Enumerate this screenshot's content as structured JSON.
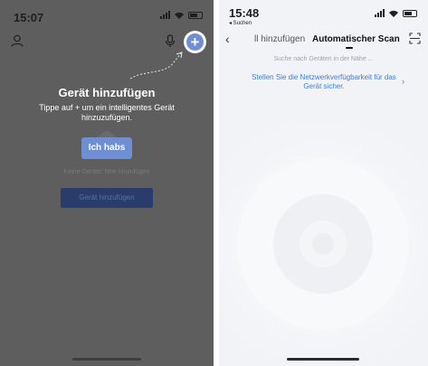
{
  "left": {
    "status_time": "15:07",
    "title": "Gerät hinzufügen",
    "subtitle": "Tippe auf + um ein intelligentes Gerät hinzuzufügen.",
    "ok_button": "Ich habs",
    "empty_text": "Keine Geräte; bitte hinzufügen",
    "add_device_button": "Gerät hinzufügen",
    "add_symbol": "+"
  },
  "right": {
    "status_time": "15:48",
    "back_app": "◂ Suchen",
    "tab_manual": "ll hinzufügen",
    "tab_auto": "Automatischer Scan",
    "searching": "Suche nach Geräten in der Nähe ...",
    "network_hint": "Stellen Sie die Netzwerkverfügbarkeit für das Gerät sicher.",
    "chevron": "›",
    "back": "‹"
  },
  "colors": {
    "accent_blue": "#6f8ed3",
    "link_blue": "#3d7fd6",
    "overlay_gray": "#5e5e5e",
    "dark_button": "#2a3c6c"
  },
  "icons": [
    "location-arrow-icon",
    "profile-icon",
    "microphone-icon",
    "add-icon",
    "signal-icon",
    "wifi-icon",
    "battery-icon",
    "scan-icon",
    "back-icon"
  ]
}
